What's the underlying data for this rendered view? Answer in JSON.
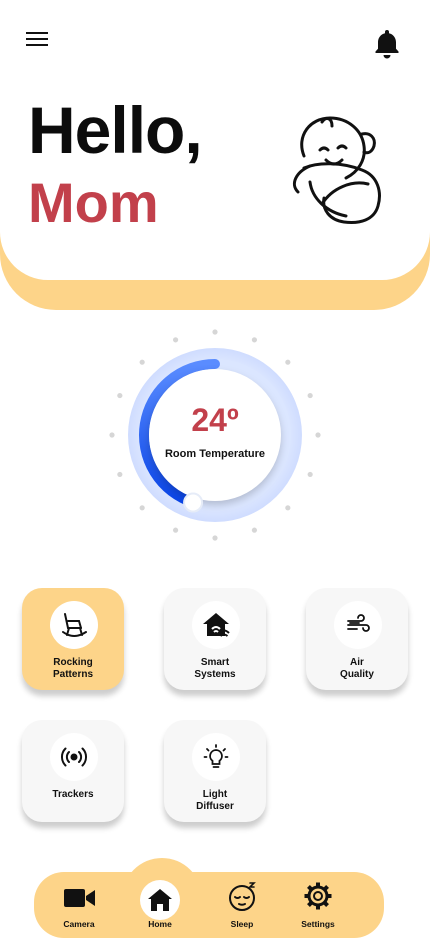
{
  "header": {
    "greeting_line1": "Hello,",
    "greeting_line2": "Mom",
    "menu_icon": "hamburger-menu-icon",
    "notification_icon": "bell-icon"
  },
  "thermostat": {
    "value": "24º",
    "label": "Room Temperature",
    "level_fraction": 0.5
  },
  "tiles": [
    {
      "label": "Rocking\nPatterns",
      "icon": "rocking-chair-icon",
      "active": true
    },
    {
      "label": "Smart\nSystems",
      "icon": "smart-home-icon",
      "active": false
    },
    {
      "label": "Air\nQuality",
      "icon": "wind-icon",
      "active": false
    },
    {
      "label": "Trackers",
      "icon": "signal-tracker-icon",
      "active": false
    },
    {
      "label": "Light\nDiffuser",
      "icon": "light-bulb-icon",
      "active": false
    }
  ],
  "nav": [
    {
      "label": "Camera",
      "icon": "video-camera-icon"
    },
    {
      "label": "Home",
      "icon": "home-icon",
      "active": true
    },
    {
      "label": "Sleep",
      "icon": "sleeping-face-icon"
    },
    {
      "label": "Settings",
      "icon": "gear-icon"
    }
  ],
  "colors": {
    "accent_yellow": "#fdd489",
    "accent_red": "#c2404b",
    "dial_blue": "#1a56f0"
  }
}
